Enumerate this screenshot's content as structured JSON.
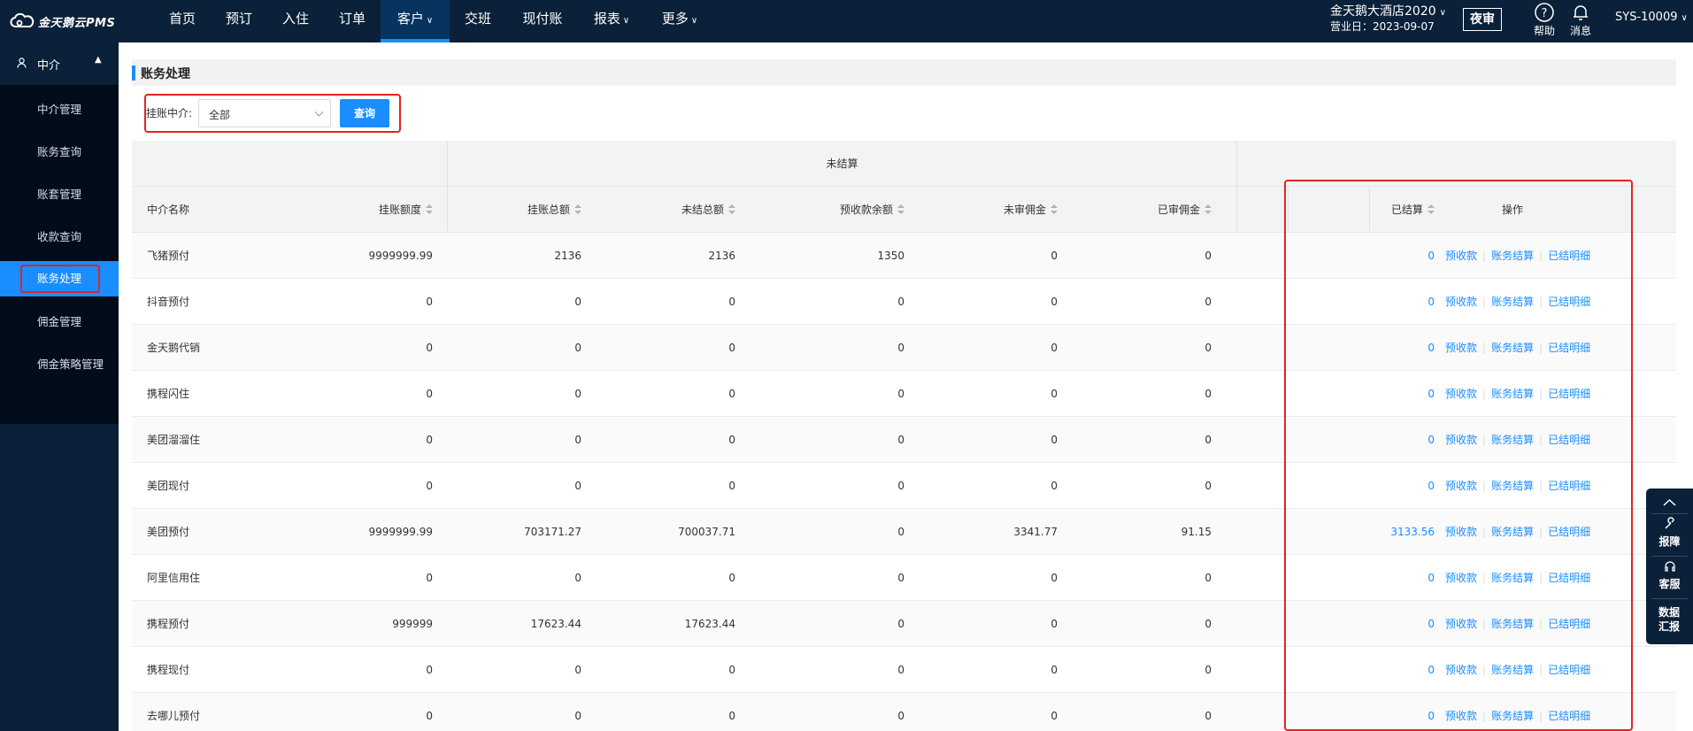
{
  "app": {
    "logo_text": "金天鹅云PMS"
  },
  "nav": {
    "items": [
      {
        "label": "首页"
      },
      {
        "label": "预订"
      },
      {
        "label": "入住"
      },
      {
        "label": "订单"
      },
      {
        "label": "客户"
      },
      {
        "label": "交班"
      },
      {
        "label": "现付账"
      },
      {
        "label": "报表"
      },
      {
        "label": "更多"
      }
    ],
    "hotel": "金天鹅大酒店2020",
    "business_date": "营业日：2023-09-07",
    "night_audit": "夜审",
    "help": "帮助",
    "messages": "消息",
    "user": "SYS-10009"
  },
  "sidebar": {
    "group": "中介",
    "items": [
      {
        "label": "中介管理"
      },
      {
        "label": "账务查询"
      },
      {
        "label": "账套管理"
      },
      {
        "label": "收款查询"
      },
      {
        "label": "账务处理"
      },
      {
        "label": "佣金管理"
      },
      {
        "label": "佣金策略管理"
      }
    ]
  },
  "page": {
    "title": "账务处理",
    "filter_label": "挂账中介:",
    "filter_value": "全部",
    "query_button": "查询"
  },
  "table": {
    "group_header": "未结算",
    "columns": [
      "中介名称",
      "挂账额度",
      "挂账总额",
      "未结总额",
      "预收款余额",
      "未审佣金",
      "已审佣金",
      "已结算",
      "操作"
    ],
    "actions": [
      "预收款",
      "账务结算",
      "已结明细"
    ],
    "rows": [
      {
        "name": "飞猪预付",
        "limit": "9999999.99",
        "total": "2136",
        "unsettled": "2136",
        "prepaid": "1350",
        "unreviewed": "0",
        "reviewed": "0",
        "settled": "0"
      },
      {
        "name": "抖音预付",
        "limit": "0",
        "total": "0",
        "unsettled": "0",
        "prepaid": "0",
        "unreviewed": "0",
        "reviewed": "0",
        "settled": "0"
      },
      {
        "name": "金天鹅代销",
        "limit": "0",
        "total": "0",
        "unsettled": "0",
        "prepaid": "0",
        "unreviewed": "0",
        "reviewed": "0",
        "settled": "0"
      },
      {
        "name": "携程闪住",
        "limit": "0",
        "total": "0",
        "unsettled": "0",
        "prepaid": "0",
        "unreviewed": "0",
        "reviewed": "0",
        "settled": "0"
      },
      {
        "name": "美团溜溜住",
        "limit": "0",
        "total": "0",
        "unsettled": "0",
        "prepaid": "0",
        "unreviewed": "0",
        "reviewed": "0",
        "settled": "0"
      },
      {
        "name": "美团现付",
        "limit": "0",
        "total": "0",
        "unsettled": "0",
        "prepaid": "0",
        "unreviewed": "0",
        "reviewed": "0",
        "settled": "0"
      },
      {
        "name": "美团预付",
        "limit": "9999999.99",
        "total": "703171.27",
        "unsettled": "700037.71",
        "prepaid": "0",
        "unreviewed": "3341.77",
        "reviewed": "91.15",
        "settled": "3133.56"
      },
      {
        "name": "阿里信用住",
        "limit": "0",
        "total": "0",
        "unsettled": "0",
        "prepaid": "0",
        "unreviewed": "0",
        "reviewed": "0",
        "settled": "0"
      },
      {
        "name": "携程预付",
        "limit": "999999",
        "total": "17623.44",
        "unsettled": "17623.44",
        "prepaid": "0",
        "unreviewed": "0",
        "reviewed": "0",
        "settled": "0"
      },
      {
        "name": "携程现付",
        "limit": "0",
        "total": "0",
        "unsettled": "0",
        "prepaid": "0",
        "unreviewed": "0",
        "reviewed": "0",
        "settled": "0"
      },
      {
        "name": "去哪儿预付",
        "limit": "0",
        "total": "0",
        "unsettled": "0",
        "prepaid": "0",
        "unreviewed": "0",
        "reviewed": "0",
        "settled": "0"
      }
    ]
  },
  "float": {
    "report": "报障",
    "service": "客服",
    "data_summary": "数据汇报"
  },
  "colors": {
    "nav_bg": "#0b2139",
    "accent": "#1a8dff",
    "highlight": "#e02424"
  }
}
